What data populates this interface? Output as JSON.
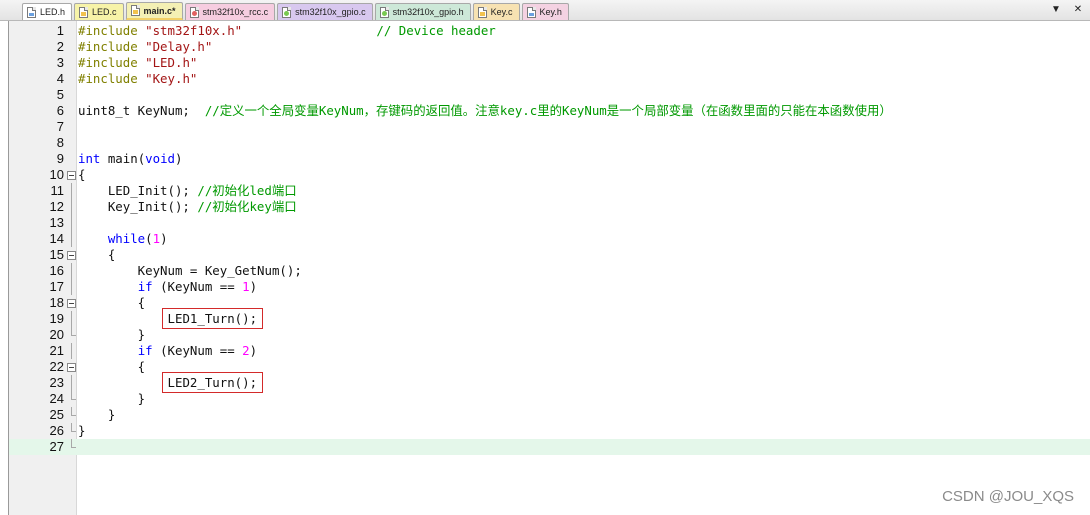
{
  "tabs": [
    {
      "label": "LED.h",
      "bg": "#ffffff",
      "kind": "b",
      "active": false
    },
    {
      "label": "LED.c",
      "bg": "#f7f3a8",
      "kind": "c",
      "active": false
    },
    {
      "label": "main.c*",
      "bg": "#f4f0b4",
      "kind": "c",
      "active": true
    },
    {
      "label": "stm32f10x_rcc.c",
      "bg": "#f6cde0",
      "kind": "k",
      "active": false
    },
    {
      "label": "stm32f10x_gpio.c",
      "bg": "#d8c8ef",
      "kind": "g",
      "active": false
    },
    {
      "label": "stm32f10x_gpio.h",
      "bg": "#cde8d8",
      "kind": "g",
      "active": false
    },
    {
      "label": "Key.c",
      "bg": "#f7e2b2",
      "kind": "c",
      "active": false
    },
    {
      "label": "Key.h",
      "bg": "#f4d2e2",
      "kind": "b",
      "active": false
    }
  ],
  "tab_controls": {
    "dropdown": "▼",
    "close": "✕"
  },
  "colors": {
    "preprocessor": "#808000",
    "string": "#a31515",
    "comment": "#009900",
    "keyword": "#0000ff",
    "number": "#ff00ff",
    "plain": "#111111",
    "highlight_box": "#d32a2a",
    "current_line": "#e4f7ea"
  },
  "code_lines": [
    {
      "n": "1",
      "fold": "",
      "tokens": [
        [
          "#include ",
          "preprocessor"
        ],
        [
          "\"stm32f10x.h\"",
          "string"
        ],
        [
          "                  ",
          "plain"
        ],
        [
          "// Device header",
          "comment"
        ]
      ]
    },
    {
      "n": "2",
      "fold": "",
      "tokens": [
        [
          "#include ",
          "preprocessor"
        ],
        [
          "\"Delay.h\"",
          "string"
        ]
      ]
    },
    {
      "n": "3",
      "fold": "",
      "tokens": [
        [
          "#include ",
          "preprocessor"
        ],
        [
          "\"LED.h\"",
          "string"
        ]
      ]
    },
    {
      "n": "4",
      "fold": "",
      "tokens": [
        [
          "#include ",
          "preprocessor"
        ],
        [
          "\"Key.h\"",
          "string"
        ]
      ]
    },
    {
      "n": "5",
      "fold": "",
      "tokens": []
    },
    {
      "n": "6",
      "fold": "",
      "tokens": [
        [
          "uint8_t KeyNum;  ",
          "plain"
        ],
        [
          "//定义一个全局变量KeyNum，存键码的返回值。注意key.c里的KeyNum是一个局部变量（在函数里面的只能在本函数使用）",
          "comment"
        ]
      ]
    },
    {
      "n": "7",
      "fold": "",
      "tokens": []
    },
    {
      "n": "8",
      "fold": "",
      "tokens": []
    },
    {
      "n": "9",
      "fold": "",
      "tokens": [
        [
          "int",
          "keyword"
        ],
        [
          " main(",
          "plain"
        ],
        [
          "void",
          "keyword"
        ],
        [
          ")",
          "plain"
        ]
      ]
    },
    {
      "n": "10",
      "fold": "open",
      "tokens": [
        [
          "{",
          "plain"
        ]
      ]
    },
    {
      "n": "11",
      "fold": "vline",
      "tokens": [
        [
          "    LED_Init(); ",
          "plain"
        ],
        [
          "//初始化led端口",
          "comment"
        ]
      ]
    },
    {
      "n": "12",
      "fold": "vline",
      "tokens": [
        [
          "    Key_Init(); ",
          "plain"
        ],
        [
          "//初始化key端口",
          "comment"
        ]
      ]
    },
    {
      "n": "13",
      "fold": "vline",
      "tokens": []
    },
    {
      "n": "14",
      "fold": "vline",
      "tokens": [
        [
          "    ",
          "plain"
        ],
        [
          "while",
          "keyword"
        ],
        [
          "(",
          "plain"
        ],
        [
          "1",
          "number"
        ],
        [
          ")",
          "plain"
        ]
      ]
    },
    {
      "n": "15",
      "fold": "open",
      "tokens": [
        [
          "    {",
          "plain"
        ]
      ]
    },
    {
      "n": "16",
      "fold": "vline",
      "tokens": [
        [
          "        KeyNum = Key_GetNum();",
          "plain"
        ]
      ]
    },
    {
      "n": "17",
      "fold": "vline",
      "tokens": [
        [
          "        ",
          "plain"
        ],
        [
          "if",
          "keyword"
        ],
        [
          " (KeyNum == ",
          "plain"
        ],
        [
          "1",
          "number"
        ],
        [
          ")",
          "plain"
        ]
      ]
    },
    {
      "n": "18",
      "fold": "open",
      "tokens": [
        [
          "        {",
          "plain"
        ]
      ]
    },
    {
      "n": "19",
      "fold": "vline",
      "tokens": [
        [
          "            ",
          "plain"
        ],
        [
          "LED1_Turn();",
          "boxed"
        ]
      ]
    },
    {
      "n": "20",
      "fold": "end",
      "tokens": [
        [
          "        }",
          "plain"
        ]
      ]
    },
    {
      "n": "21",
      "fold": "vline",
      "tokens": [
        [
          "        ",
          "plain"
        ],
        [
          "if",
          "keyword"
        ],
        [
          " (KeyNum == ",
          "plain"
        ],
        [
          "2",
          "number"
        ],
        [
          ")",
          "plain"
        ]
      ]
    },
    {
      "n": "22",
      "fold": "open",
      "tokens": [
        [
          "        {",
          "plain"
        ]
      ]
    },
    {
      "n": "23",
      "fold": "vline",
      "tokens": [
        [
          "            ",
          "plain"
        ],
        [
          "LED2_Turn();",
          "boxed"
        ]
      ]
    },
    {
      "n": "24",
      "fold": "end",
      "tokens": [
        [
          "        }",
          "plain"
        ]
      ]
    },
    {
      "n": "25",
      "fold": "end",
      "tokens": [
        [
          "    }",
          "plain"
        ]
      ]
    },
    {
      "n": "26",
      "fold": "end",
      "tokens": [
        [
          "}",
          "plain"
        ]
      ]
    },
    {
      "n": "27",
      "fold": "end",
      "tokens": [],
      "current": true
    }
  ],
  "watermark": "CSDN @JOU_XQS"
}
